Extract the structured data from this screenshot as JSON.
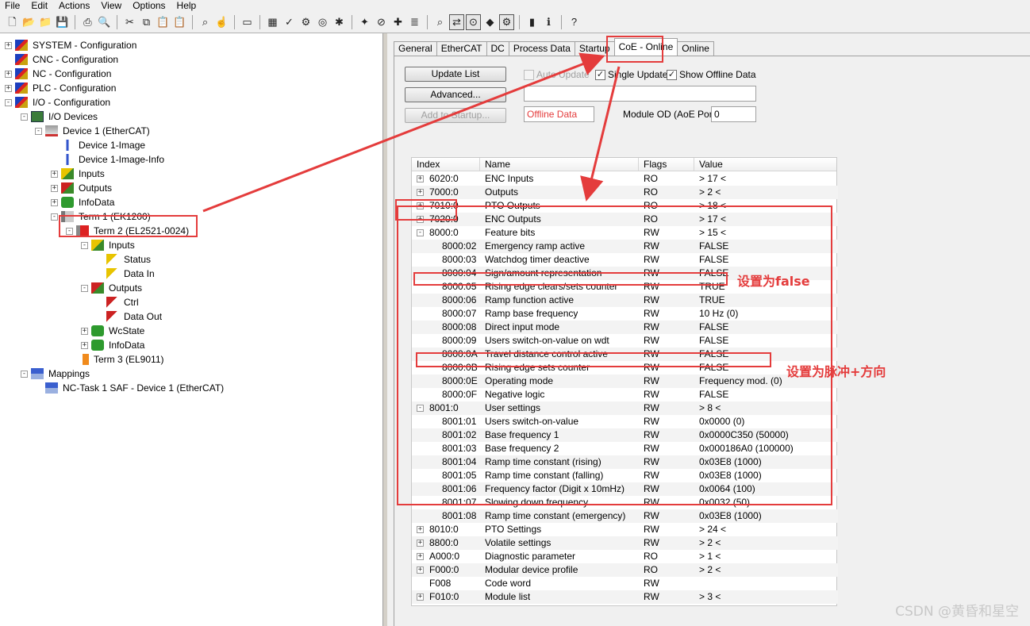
{
  "menu": [
    "File",
    "Edit",
    "Actions",
    "View",
    "Options",
    "Help"
  ],
  "toolbar_icons": [
    "new-icon",
    "open-icon",
    "open-folder-icon",
    "save-icon",
    "print-icon",
    "print-preview-icon",
    "cut-icon",
    "copy-icon",
    "paste-icon",
    "paste-special-icon",
    "find-icon",
    "find-next-icon",
    "monitor-icon",
    "activate-config-icon",
    "check-icon",
    "build-icon",
    "target-icon",
    "scan-icon",
    "wand-icon",
    "stop-icon",
    "add-icon",
    "list-icon",
    "zoom-icon",
    "toggle-mode-icon",
    "glasses-icon",
    "tag-icon",
    "settings-icon",
    "book-icon",
    "info-icon",
    "help-icon"
  ],
  "tree": {
    "nodes": [
      {
        "label": "SYSTEM - Configuration",
        "exp": "+"
      },
      {
        "label": "CNC - Configuration",
        "exp": ""
      },
      {
        "label": "NC - Configuration",
        "exp": "+"
      },
      {
        "label": "PLC - Configuration",
        "exp": "+"
      },
      {
        "label": "I/O - Configuration",
        "exp": "-"
      },
      {
        "label": "I/O Devices",
        "exp": "-"
      },
      {
        "label": "Device 1 (EtherCAT)",
        "exp": "-"
      },
      {
        "label": "Device 1-Image",
        "exp": ""
      },
      {
        "label": "Device 1-Image-Info",
        "exp": ""
      },
      {
        "label": "Inputs",
        "exp": "+"
      },
      {
        "label": "Outputs",
        "exp": "+"
      },
      {
        "label": "InfoData",
        "exp": "+"
      },
      {
        "label": "Term 1 (EK1200)",
        "exp": "-"
      },
      {
        "label": "Term 2 (EL2521-0024)",
        "exp": "-"
      },
      {
        "label": "Inputs",
        "exp": "-"
      },
      {
        "label": "Status",
        "exp": ""
      },
      {
        "label": "Data In",
        "exp": ""
      },
      {
        "label": "Outputs",
        "exp": "-"
      },
      {
        "label": "Ctrl",
        "exp": ""
      },
      {
        "label": "Data Out",
        "exp": ""
      },
      {
        "label": "WcState",
        "exp": "+"
      },
      {
        "label": "InfoData",
        "exp": "+"
      },
      {
        "label": "Term 3 (EL9011)",
        "exp": ""
      },
      {
        "label": "Mappings",
        "exp": "-"
      },
      {
        "label": "NC-Task 1 SAF - Device 1 (EtherCAT)",
        "exp": ""
      }
    ]
  },
  "tabs": [
    "General",
    "EtherCAT",
    "DC",
    "Process Data",
    "Startup",
    "CoE - Online",
    "Online"
  ],
  "coe": {
    "update_list": "Update List",
    "advanced": "Advanced...",
    "add_to_startup": "Add to Startup...",
    "auto_update": "Auto Update",
    "single_update": "Single Update",
    "show_offline": "Show Offline Data",
    "check_mark": "✓",
    "offline_data": "Offline Data",
    "module_od_label": "Module OD (AoE Port):",
    "module_od_value": "0",
    "columns": [
      "Index",
      "Name",
      "Flags",
      "Value"
    ],
    "rows": [
      {
        "exp": "+",
        "index": "6020:0",
        "name": "ENC Inputs",
        "flags": "RO",
        "value": "> 17 <"
      },
      {
        "exp": "+",
        "index": "7000:0",
        "name": "Outputs",
        "flags": "RO",
        "value": "> 2 <"
      },
      {
        "exp": "+",
        "index": "7010:0",
        "name": "PTO Outputs",
        "flags": "RO",
        "value": "> 18 <"
      },
      {
        "exp": "+",
        "index": "7020:0",
        "name": "ENC Outputs",
        "flags": "RO",
        "value": "> 17 <"
      },
      {
        "exp": "-",
        "index": "8000:0",
        "name": "Feature bits",
        "flags": "RW",
        "value": "> 15 <"
      },
      {
        "exp": "",
        "index": "8000:02",
        "name": "Emergency ramp active",
        "flags": "RW",
        "value": "FALSE"
      },
      {
        "exp": "",
        "index": "8000:03",
        "name": "Watchdog timer deactive",
        "flags": "RW",
        "value": "FALSE"
      },
      {
        "exp": "",
        "index": "8000:04",
        "name": "Sign/amount representation",
        "flags": "RW",
        "value": "FALSE"
      },
      {
        "exp": "",
        "index": "8000:05",
        "name": "Rising edge clears/sets counter",
        "flags": "RW",
        "value": "TRUE"
      },
      {
        "exp": "",
        "index": "8000:06",
        "name": "Ramp function active",
        "flags": "RW",
        "value": "TRUE"
      },
      {
        "exp": "",
        "index": "8000:07",
        "name": "Ramp base frequency",
        "flags": "RW",
        "value": "10 Hz (0)"
      },
      {
        "exp": "",
        "index": "8000:08",
        "name": "Direct input mode",
        "flags": "RW",
        "value": "FALSE"
      },
      {
        "exp": "",
        "index": "8000:09",
        "name": "Users switch-on-value on wdt",
        "flags": "RW",
        "value": "FALSE"
      },
      {
        "exp": "",
        "index": "8000:0A",
        "name": "Travel distance control active",
        "flags": "RW",
        "value": "FALSE"
      },
      {
        "exp": "",
        "index": "8000:0B",
        "name": "Rising edge sets counter",
        "flags": "RW",
        "value": "FALSE"
      },
      {
        "exp": "",
        "index": "8000:0E",
        "name": "Operating mode",
        "flags": "RW",
        "value": "Frequency mod. (0)"
      },
      {
        "exp": "",
        "index": "8000:0F",
        "name": "Negative logic",
        "flags": "RW",
        "value": "FALSE"
      },
      {
        "exp": "-",
        "index": "8001:0",
        "name": "User settings",
        "flags": "RW",
        "value": "> 8 <"
      },
      {
        "exp": "",
        "index": "8001:01",
        "name": "Users switch-on-value",
        "flags": "RW",
        "value": "0x0000 (0)"
      },
      {
        "exp": "",
        "index": "8001:02",
        "name": "Base frequency 1",
        "flags": "RW",
        "value": "0x0000C350 (50000)"
      },
      {
        "exp": "",
        "index": "8001:03",
        "name": "Base frequency 2",
        "flags": "RW",
        "value": "0x000186A0 (100000)"
      },
      {
        "exp": "",
        "index": "8001:04",
        "name": "Ramp time constant (rising)",
        "flags": "RW",
        "value": "0x03E8 (1000)"
      },
      {
        "exp": "",
        "index": "8001:05",
        "name": "Ramp time constant (falling)",
        "flags": "RW",
        "value": "0x03E8 (1000)"
      },
      {
        "exp": "",
        "index": "8001:06",
        "name": "Frequency factor (Digit x 10mHz)",
        "flags": "RW",
        "value": "0x0064 (100)"
      },
      {
        "exp": "",
        "index": "8001:07",
        "name": "Slowing down frequency",
        "flags": "RW",
        "value": "0x0032 (50)"
      },
      {
        "exp": "",
        "index": "8001:08",
        "name": "Ramp time constant (emergency)",
        "flags": "RW",
        "value": "0x03E8 (1000)"
      },
      {
        "exp": "+",
        "index": "8010:0",
        "name": "PTO Settings",
        "flags": "RW",
        "value": "> 24 <"
      },
      {
        "exp": "+",
        "index": "8800:0",
        "name": "Volatile settings",
        "flags": "RW",
        "value": "> 2 <"
      },
      {
        "exp": "+",
        "index": "A000:0",
        "name": "Diagnostic parameter",
        "flags": "RO",
        "value": "> 1 <"
      },
      {
        "exp": "+",
        "index": "F000:0",
        "name": "Modular device profile",
        "flags": "RO",
        "value": "> 2 <"
      },
      {
        "exp": "",
        "index": "F008",
        "name": "Code word",
        "flags": "RW",
        "value": ""
      },
      {
        "exp": "+",
        "index": "F010:0",
        "name": "Module list",
        "flags": "RW",
        "value": "> 3 <"
      }
    ]
  },
  "annotations": {
    "set_false": "设置为false",
    "set_pulse_dir": "设置为脉冲+方向",
    "color": "#e43c3c"
  },
  "watermark": "CSDN @黄昏和星空"
}
